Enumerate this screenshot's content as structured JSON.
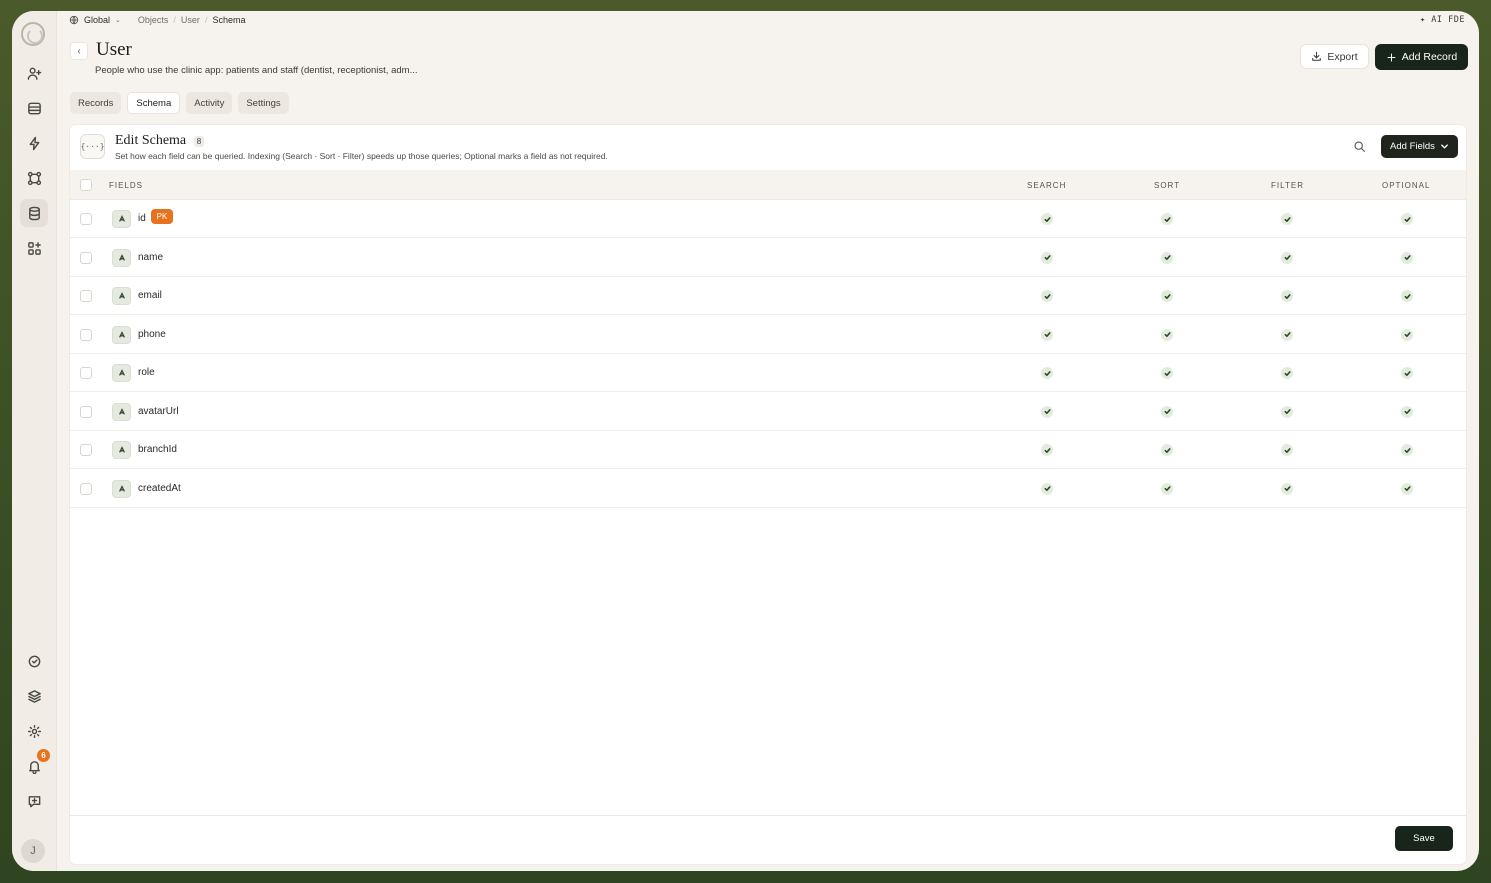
{
  "breadcrumb": {
    "scope": "Global",
    "items": [
      "Objects",
      "User"
    ],
    "current": "Schema"
  },
  "topbar": {
    "ai_label": "✦ AI FDE"
  },
  "header": {
    "title": "User",
    "description": "People who use the clinic app: patients and staff (dentist, receptionist, adm...",
    "export_label": "Export",
    "add_record_label": "Add Record"
  },
  "tabs": [
    {
      "label": "Records"
    },
    {
      "label": "Schema",
      "active": true
    },
    {
      "label": "Activity"
    },
    {
      "label": "Settings"
    }
  ],
  "schema": {
    "icon_text": "{···}",
    "title": "Edit Schema",
    "count": "8",
    "description": "Set how each field can be queried. Indexing (Search · Sort · Filter) speeds up those queries; Optional marks a field as not required.",
    "add_fields_label": "Add Fields",
    "columns": {
      "fields": "FIELDS",
      "search": "SEARCH",
      "sort": "SORT",
      "filter": "FILTER",
      "optional": "OPTIONAL"
    },
    "rows": [
      {
        "name": "id",
        "badge": "PK"
      },
      {
        "name": "name"
      },
      {
        "name": "email"
      },
      {
        "name": "phone"
      },
      {
        "name": "role"
      },
      {
        "name": "avatarUrl"
      },
      {
        "name": "branchId"
      },
      {
        "name": "createdAt"
      }
    ],
    "save_label": "Save"
  },
  "sidebar": {
    "notification_count": "6",
    "avatar_initial": "J"
  },
  "colors": {
    "accent": "#18251a",
    "badge": "#e8731e",
    "check_bg": "#e2ebdd"
  }
}
